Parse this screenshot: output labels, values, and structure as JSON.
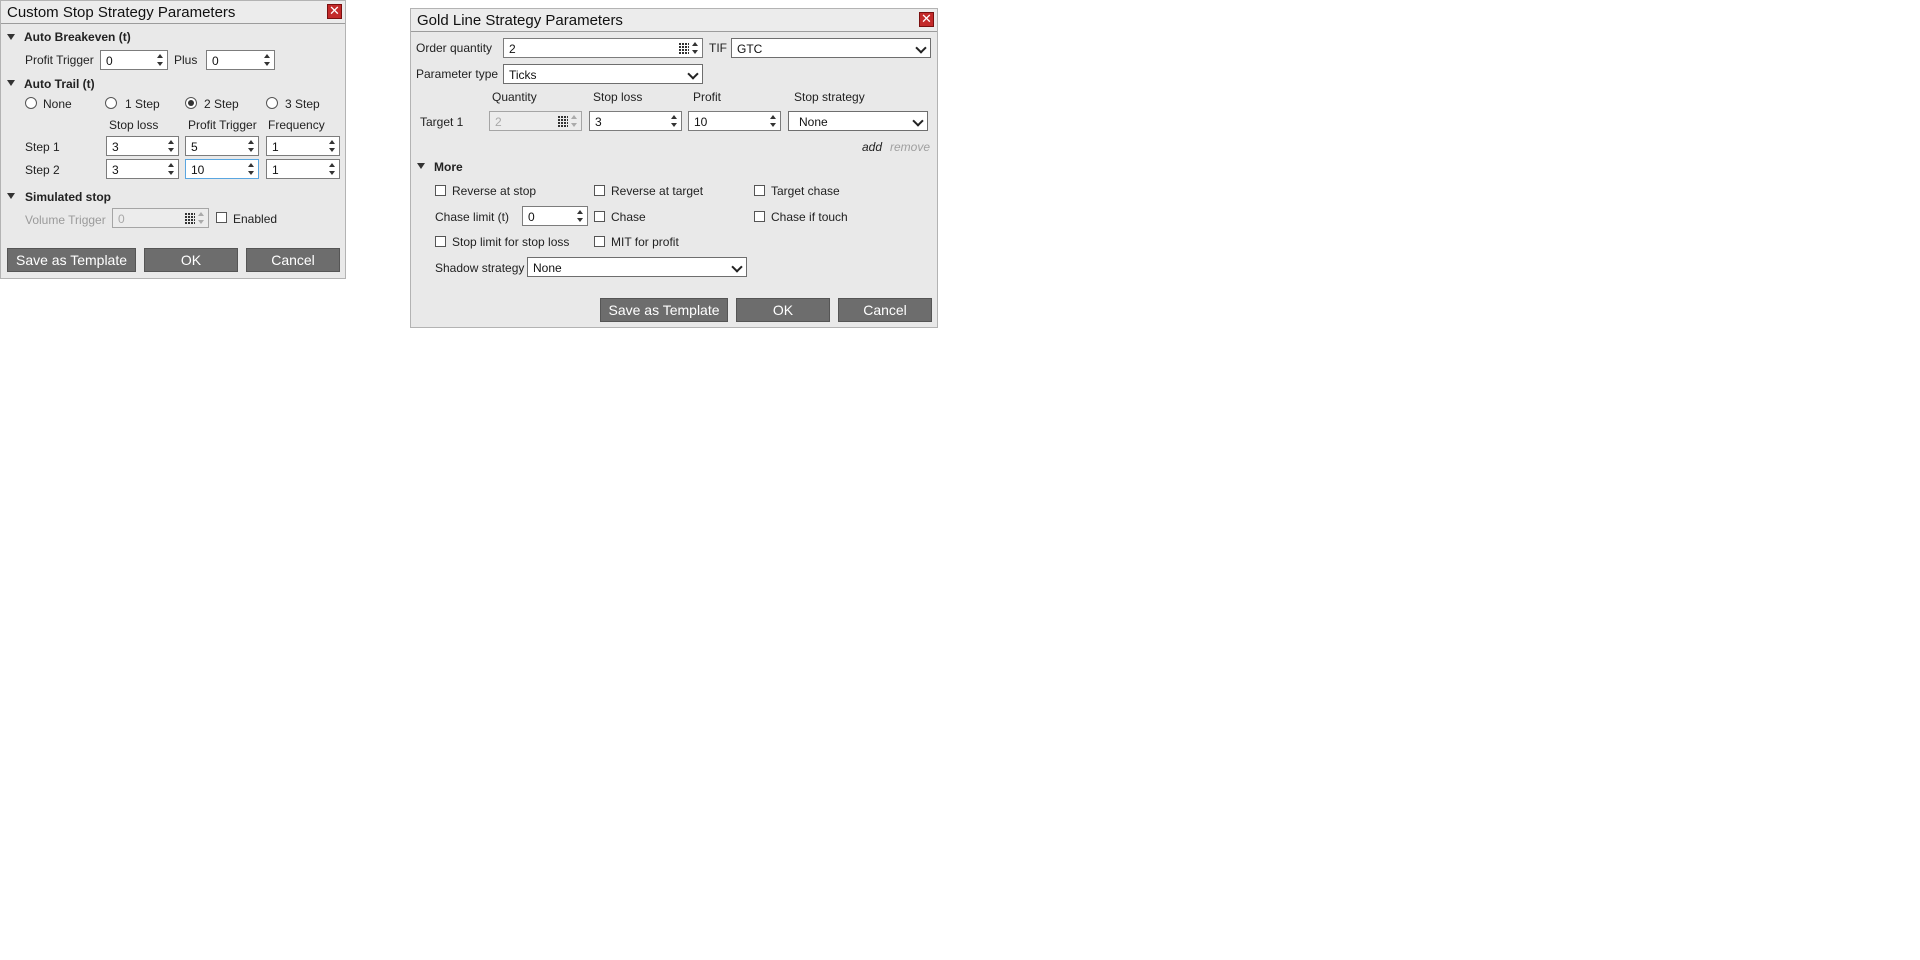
{
  "custom_stop": {
    "title": "Custom Stop Strategy Parameters",
    "close_icon": "close-icon",
    "auto_breakeven": {
      "header": "Auto Breakeven (t)",
      "profit_trigger_label": "Profit Trigger",
      "profit_trigger_value": "0",
      "plus_label": "Plus",
      "plus_value": "0"
    },
    "auto_trail": {
      "header": "Auto Trail (t)",
      "options": [
        "None",
        "1 Step",
        "2 Step",
        "3 Step"
      ],
      "selected": "2 Step",
      "columns": [
        "Stop loss",
        "Profit Trigger",
        "Frequency"
      ],
      "rows": [
        {
          "label": "Step 1",
          "stop_loss": "3",
          "profit_trigger": "5",
          "frequency": "1"
        },
        {
          "label": "Step 2",
          "stop_loss": "3",
          "profit_trigger": "10",
          "frequency": "1"
        }
      ]
    },
    "simulated_stop": {
      "header": "Simulated stop",
      "volume_trigger_label": "Volume Trigger",
      "volume_trigger_value": "0",
      "enabled_label": "Enabled",
      "enabled_checked": false
    },
    "buttons": {
      "template": "Save as Template",
      "ok": "OK",
      "cancel": "Cancel"
    }
  },
  "gold_line": {
    "title": "Gold Line Strategy Parameters",
    "close_icon": "close-icon",
    "order_quantity_label": "Order quantity",
    "order_quantity_value": "2",
    "tif_label": "TIF",
    "tif_value": "GTC",
    "parameter_type_label": "Parameter type",
    "parameter_type_value": "Ticks",
    "target_columns": [
      "Quantity",
      "Stop loss",
      "Profit",
      "Stop strategy"
    ],
    "targets": [
      {
        "label": "Target 1",
        "quantity": "2",
        "stop_loss": "3",
        "profit": "10",
        "stop_strategy": "None"
      }
    ],
    "add_label": "add",
    "remove_label": "remove",
    "more": {
      "header": "More",
      "reverse_at_stop": "Reverse at stop",
      "reverse_at_target": "Reverse at target",
      "target_chase": "Target chase",
      "chase_limit_label": "Chase limit (t)",
      "chase_limit_value": "0",
      "chase": "Chase",
      "chase_if_touch": "Chase if touch",
      "stop_limit_for_stop_loss": "Stop limit for stop loss",
      "mit_for_profit": "MIT for profit",
      "shadow_strategy_label": "Shadow strategy",
      "shadow_strategy_value": "None"
    },
    "buttons": {
      "template": "Save as Template",
      "ok": "OK",
      "cancel": "Cancel"
    }
  },
  "colors": {
    "dialog_bg": "#e9e9e9",
    "button_bg": "#6d6d6d",
    "close_red": "#c32a2a",
    "focus_blue": "#5aa6e0",
    "link_blue": "#222222",
    "disabled_text": "#9a9a9a"
  }
}
